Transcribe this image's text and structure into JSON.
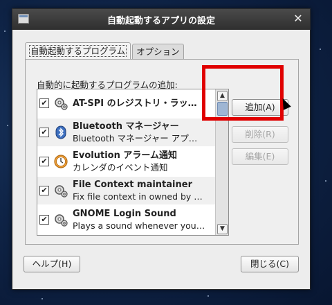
{
  "window": {
    "title": "自動起動するアプリの設定"
  },
  "tabs": [
    {
      "label": "自動起動するプログラム",
      "active": true
    },
    {
      "label": "オプション",
      "active": false
    }
  ],
  "section_label": "自動的に起動するプログラムの追加:",
  "programs": [
    {
      "name": "AT-SPI のレジストリ・ラッ…",
      "desc": "",
      "checked": true,
      "icon": "gears-icon"
    },
    {
      "name": "Bluetooth マネージャー",
      "desc": "Bluetooth マネージャー アプ…",
      "checked": true,
      "icon": "bluetooth-icon"
    },
    {
      "name": "Evolution アラーム通知",
      "desc": "カレンダのイベント通知",
      "checked": true,
      "icon": "clock-icon"
    },
    {
      "name": "File Context maintainer",
      "desc": "Fix file context in owned by …",
      "checked": true,
      "icon": "gears-icon"
    },
    {
      "name": "GNOME Login Sound",
      "desc": "Plays a sound whenever you…",
      "checked": true,
      "icon": "gears-icon"
    }
  ],
  "buttons": {
    "add": "追加(A)",
    "remove": "削除(R)",
    "edit": "編集(E)",
    "help": "ヘルプ(H)",
    "close": "閉じる(C)"
  },
  "colors": {
    "highlight": "#e00000",
    "titlebar": "#3a3a3a"
  }
}
